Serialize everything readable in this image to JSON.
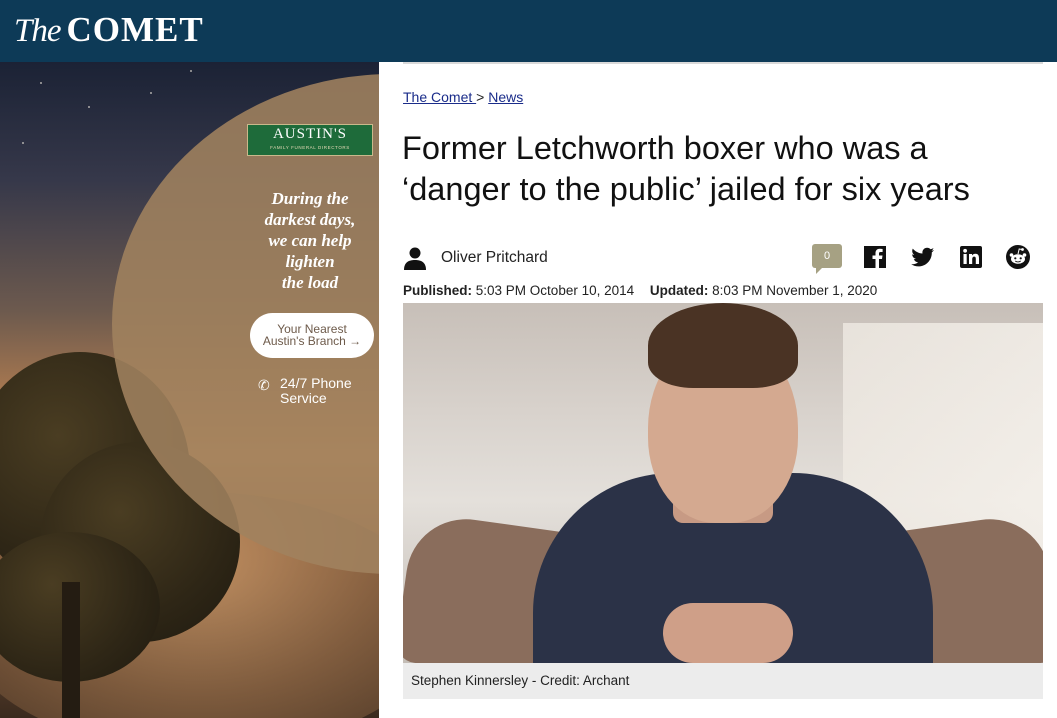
{
  "site": {
    "logo_the": "The",
    "logo_comet": "COMET",
    "brand_color": "#0d3a57"
  },
  "ad": {
    "brand_name": "AUSTIN'S",
    "brand_sub": "FAMILY FUNERAL DIRECTORS",
    "tagline_lines": [
      "During the",
      "darkest days,",
      "we can help",
      "lighten",
      "the load"
    ],
    "branch_lines": [
      "Your Nearest",
      "Austin's Branch →"
    ],
    "phone_lines": [
      "24/7 Phone",
      "Service"
    ],
    "brand_color": "#1e6b3a"
  },
  "breadcrumb": {
    "home": "The Comet ",
    "separator": ">",
    "section": "News"
  },
  "article": {
    "headline_line1": "Former Letchworth boxer who was a",
    "headline_line2": "‘danger to the public’ jailed for six years",
    "author": "Oliver Pritchard",
    "comment_count": "0",
    "published_label": "Published:",
    "published_value": "5:03 PM October 10, 2014",
    "updated_label": "Updated:",
    "updated_value": "8:03 PM November 1, 2020",
    "caption": "Stephen Kinnersley - Credit: Archant"
  },
  "share_icons": [
    "facebook-icon",
    "twitter-icon",
    "linkedin-icon",
    "reddit-icon"
  ]
}
